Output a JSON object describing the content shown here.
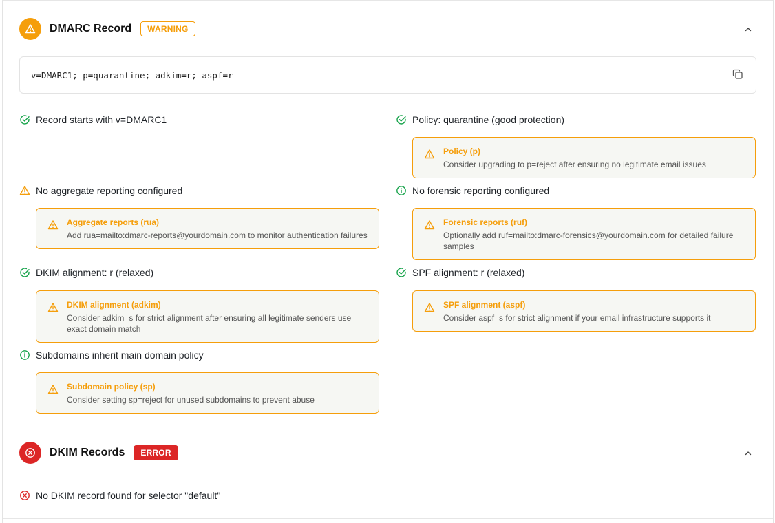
{
  "dmarc": {
    "title": "DMARC Record",
    "badge": "WARNING",
    "record": "v=DMARC1; p=quarantine; adkim=r; aspf=r",
    "checks": [
      {
        "status": "ok",
        "text": "Record starts with v=DMARC1"
      },
      {
        "status": "ok",
        "text": "Policy: quarantine (good protection)"
      },
      {
        "status": "warn",
        "text": "No aggregate reporting configured"
      },
      {
        "status": "info",
        "text": "No forensic reporting configured"
      },
      {
        "status": "ok",
        "text": "DKIM alignment: r (relaxed)"
      },
      {
        "status": "ok",
        "text": "SPF alignment: r (relaxed)"
      },
      {
        "status": "info",
        "text": "Subdomains inherit main domain policy"
      }
    ],
    "advice": [
      {
        "title": "Policy (p)",
        "body": "Consider upgrading to p=reject after ensuring no legitimate email issues"
      },
      {
        "title": "Aggregate reports (rua)",
        "body": "Add rua=mailto:dmarc-reports@yourdomain.com to monitor authentication failures"
      },
      {
        "title": "Forensic reports (ruf)",
        "body": "Optionally add ruf=mailto:dmarc-forensics@yourdomain.com for detailed failure samples"
      },
      {
        "title": "DKIM alignment (adkim)",
        "body": "Consider adkim=s for strict alignment after ensuring all legitimate senders use exact domain match"
      },
      {
        "title": "SPF alignment (aspf)",
        "body": "Consider aspf=s for strict alignment if your email infrastructure supports it"
      },
      {
        "title": "Subdomain policy (sp)",
        "body": "Consider setting sp=reject for unused subdomains to prevent abuse"
      }
    ]
  },
  "dkim": {
    "title": "DKIM Records",
    "badge": "ERROR",
    "checks": [
      {
        "status": "error",
        "text": "No DKIM record found for selector \"default\""
      }
    ]
  },
  "colors": {
    "warning": "#f59e0b",
    "error": "#dc2626",
    "success": "#16a34a",
    "advice_bg": "#f6f7f3"
  },
  "icons": {
    "ok": "check-circle-icon",
    "warn": "warning-triangle-icon",
    "info": "info-circle-icon",
    "error": "x-circle-icon",
    "copy": "copy-icon",
    "collapse": "chevron-up-icon"
  }
}
